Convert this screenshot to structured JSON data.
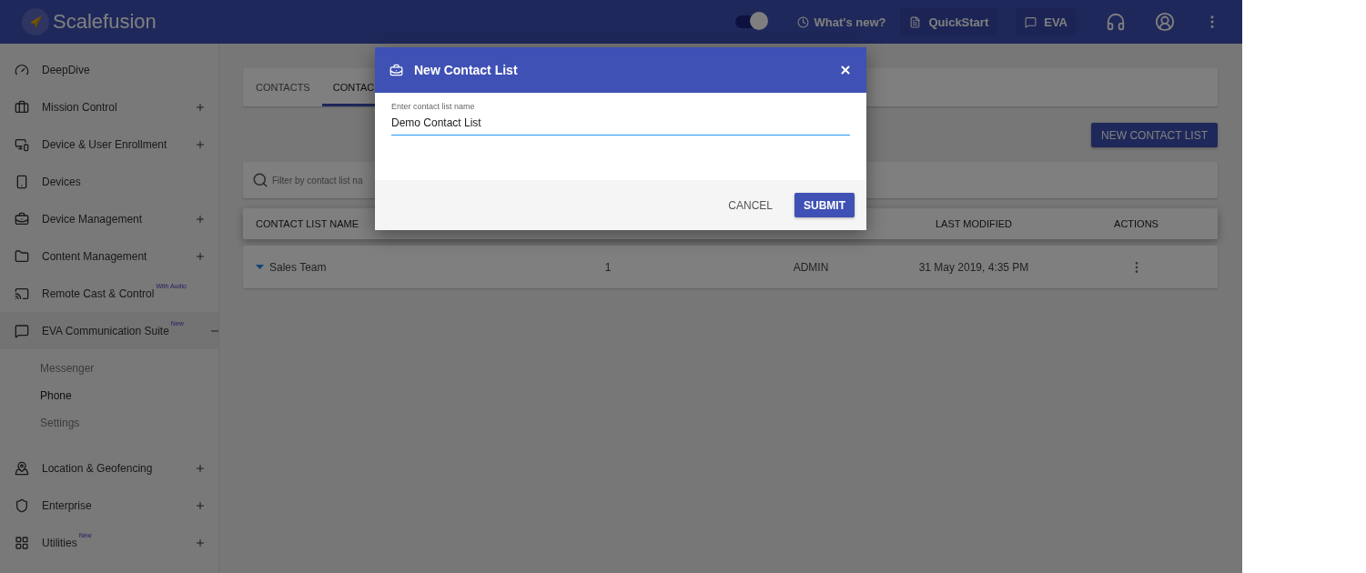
{
  "header": {
    "brand": "Scalefusion",
    "toggle": {
      "on": true
    },
    "whats_new": "What's new?",
    "buttons": [
      "QuickStart",
      "EVA"
    ]
  },
  "sidebar": {
    "items": [
      {
        "label": "DeepDive"
      },
      {
        "label": "Mission Control",
        "expanded": false
      },
      {
        "label": "Device & User Enrollment",
        "expanded": false
      },
      {
        "label": "Devices"
      },
      {
        "label": "Device Management",
        "expanded": false
      },
      {
        "label": "Content Management",
        "expanded": false
      },
      {
        "label": "Remote Cast & Control",
        "badge": "With Audio"
      },
      {
        "label": "EVA Communication Suite",
        "badge": "New",
        "expanded": true,
        "children": [
          {
            "label": "Messenger",
            "selected": false
          },
          {
            "label": "Phone",
            "selected": true
          },
          {
            "label": "Settings",
            "selected": false
          }
        ]
      },
      {
        "label": "Location & Geofencing",
        "expanded": false
      },
      {
        "label": "Enterprise",
        "expanded": false
      },
      {
        "label": "Utilities",
        "badge": "New",
        "expanded": false
      }
    ]
  },
  "tabs": [
    {
      "label": "CONTACTS",
      "selected": false
    },
    {
      "label": "CONTAC",
      "selected": true
    }
  ],
  "new_button": "NEW CONTACT LIST",
  "filter": {
    "placeholder": "Filter by contact list na"
  },
  "table": {
    "columns": [
      "CONTACT LIST NAME",
      "LAST MODIFIED",
      "ACTIONS"
    ],
    "rows": [
      {
        "name": "Sales Team",
        "column_2": "1",
        "column_3": "ADMIN",
        "last_modified": "31 May 2019, 4:35 PM"
      }
    ]
  },
  "dialog": {
    "title": "New Contact List",
    "field_label": "Enter contact list name",
    "value": "Demo Contact List",
    "buttons": [
      {
        "label": "CANCEL",
        "kind": "text"
      },
      {
        "label": "SUBMIT",
        "kind": "primary"
      }
    ]
  }
}
